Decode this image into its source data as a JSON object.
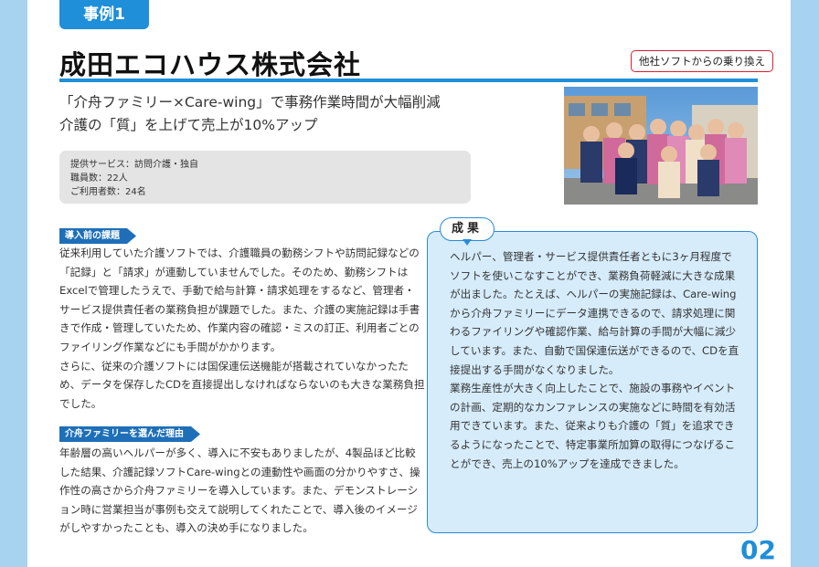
{
  "case_tag": "事例1",
  "company_name": "成田エコハウス株式会社",
  "switch_badge": "他社ソフトからの乗り換え",
  "headline": {
    "line1": "「介舟ファミリー×Care-wing」で事務作業時間が大幅削減",
    "line2": "介護の「質」を上げて売上が10%アップ"
  },
  "info": {
    "service": "提供サービス：訪問介護・独自",
    "staff": "職員数：22人",
    "users": "ご利用者数：24名"
  },
  "sections": {
    "before_title": "導入前の課題",
    "before_p1": "従来利用していた介護ソフトでは、介護職員の勤務シフトや訪問記録などの「記録」と「請求」が連動していませんでした。そのため、勤務シフトはExcelで管理したうえで、手動で給与計算・請求処理をするなど、管理者・サービス提供責任者の業務負担が課題でした。また、介護の実施記録は手書きで作成・管理していたため、作業内容の確認・ミスの訂正、利用者ごとのファイリング作業などにも手間がかかります。",
    "before_p2": "さらに、従来の介護ソフトには国保連伝送機能が搭載されていなかったため、データを保存したCDを直接提出しなければならないのも大きな業務負担でした。",
    "reason_title": "介舟ファミリーを選んだ理由",
    "reason_p1": "年齢層の高いヘルパーが多く、導入に不安もありましたが、4製品ほど比較した結果、介護記録ソフトCare-wingとの連動性や画面の分かりやすさ、操作性の高さから介舟ファミリーを導入しています。また、デモンストレーション時に営業担当が事例も交えて説明してくれたことで、導入後のイメージがしやすかったことも、導入の決め手になりました。"
  },
  "result": {
    "label": "成果",
    "p1": "ヘルパー、管理者・サービス提供責任者ともに3ヶ月程度でソフトを使いこなすことができ、業務負荷軽減に大きな成果が出ました。たとえば、ヘルパーの実施記録は、Care-wingから介舟ファミリーにデータ連携できるので、請求処理に関わるファイリングや確認作業、給与計算の手間が大幅に減少しています。また、自動で国保連伝送ができるので、CDを直接提出する手間がなくなりました。",
    "p2": "業務生産性が大きく向上したことで、施設の事務やイベントの計画、定期的なカンファレンスの実施などに時間を有効活用できています。また、従来よりも介護の「質」を追求できるようになったことで、特定事業所加算の取得につなげることができ、売上の10%アップを達成できました。"
  },
  "page_number": "02",
  "colors": {
    "accent": "#1e8fd8",
    "badge_border": "#d8202c",
    "result_bg": "#d6ecfb",
    "side_bg": "#a7d3f0"
  }
}
